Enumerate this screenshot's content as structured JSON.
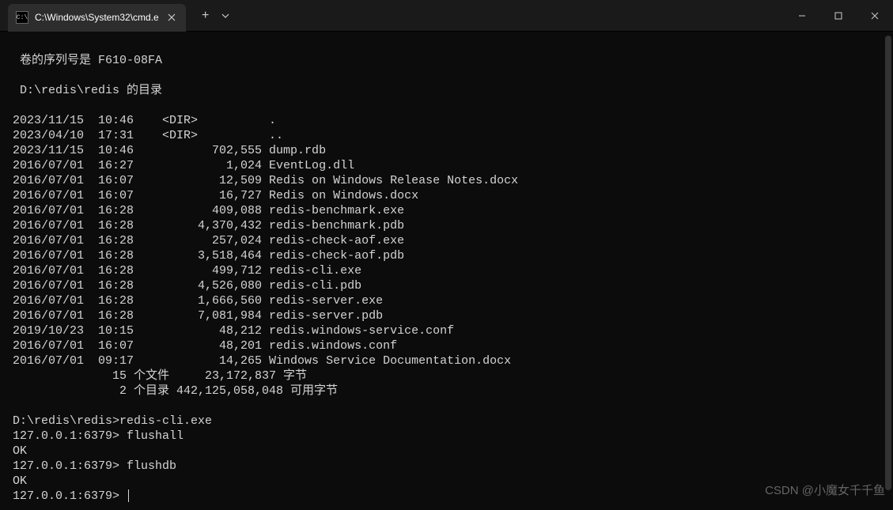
{
  "titlebar": {
    "tab_icon": "C:\\",
    "tab_title": "C:\\Windows\\System32\\cmd.e",
    "new_tab": "+",
    "dropdown": "⌄"
  },
  "window_controls": {
    "minimize": "—",
    "maximize": "☐",
    "close": "✕"
  },
  "terminal": {
    "line1": " 卷的序列号是 F610-08FA",
    "line2": "",
    "line3": " D:\\redis\\redis 的目录",
    "line4": "",
    "line5": "2023/11/15  10:46    <DIR>          .",
    "line6": "2023/04/10  17:31    <DIR>          ..",
    "line7": "2023/11/15  10:46           702,555 dump.rdb",
    "line8": "2016/07/01  16:27             1,024 EventLog.dll",
    "line9": "2016/07/01  16:07            12,509 Redis on Windows Release Notes.docx",
    "line10": "2016/07/01  16:07            16,727 Redis on Windows.docx",
    "line11": "2016/07/01  16:28           409,088 redis-benchmark.exe",
    "line12": "2016/07/01  16:28         4,370,432 redis-benchmark.pdb",
    "line13": "2016/07/01  16:28           257,024 redis-check-aof.exe",
    "line14": "2016/07/01  16:28         3,518,464 redis-check-aof.pdb",
    "line15": "2016/07/01  16:28           499,712 redis-cli.exe",
    "line16": "2016/07/01  16:28         4,526,080 redis-cli.pdb",
    "line17": "2016/07/01  16:28         1,666,560 redis-server.exe",
    "line18": "2016/07/01  16:28         7,081,984 redis-server.pdb",
    "line19": "2019/10/23  10:15            48,212 redis.windows-service.conf",
    "line20": "2016/07/01  16:07            48,201 redis.windows.conf",
    "line21": "2016/07/01  09:17            14,265 Windows Service Documentation.docx",
    "line22": "              15 个文件     23,172,837 字节",
    "line23": "               2 个目录 442,125,058,048 可用字节",
    "line24": "",
    "line25": "D:\\redis\\redis>redis-cli.exe",
    "line26": "127.0.0.1:6379> flushall",
    "line27": "OK",
    "line28": "127.0.0.1:6379> flushdb",
    "line29": "OK",
    "line30": "127.0.0.1:6379> "
  },
  "watermark": "CSDN @小魔女千千鱼"
}
